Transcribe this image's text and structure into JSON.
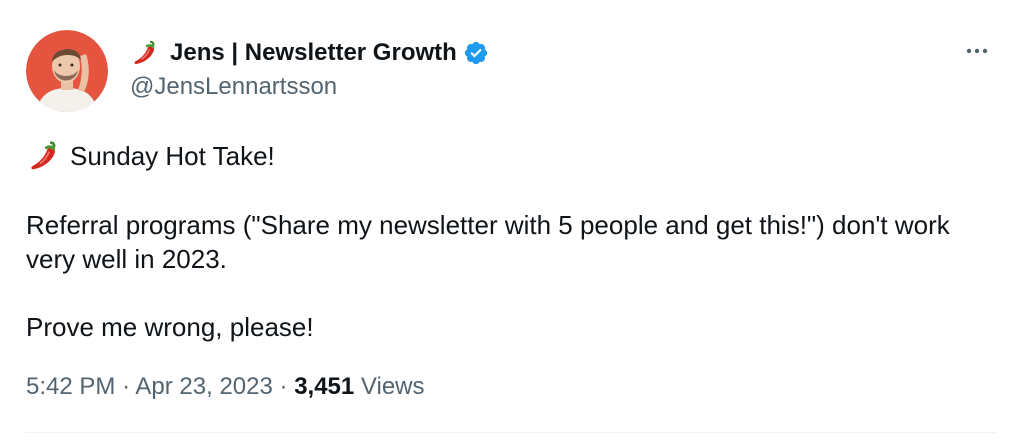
{
  "author": {
    "name": "Jens | Newsletter Growth",
    "handle": "@JensLennartsson",
    "name_emoji_icon": "chili-pepper-icon",
    "verified_icon": "verified-badge-icon",
    "verified_color": "#1d9bf0"
  },
  "tweet": {
    "line1_emoji_icon": "chili-pepper-icon",
    "line1": "Sunday Hot Take!",
    "para2": "Referral programs (\"Share my newsletter with 5 people and get this!\") don't work very well in 2023.",
    "para3": "Prove me wrong, please!"
  },
  "meta": {
    "time": "5:42 PM",
    "separator1": "·",
    "date": "Apr 23, 2023",
    "separator2": "·",
    "views_count": "3,451",
    "views_label": "Views"
  },
  "actions": {
    "more_icon": "more-horizontal-icon"
  },
  "colors": {
    "text_primary": "#0f1419",
    "text_secondary": "#536471",
    "divider": "#eff3f4",
    "avatar_bg": "#e5543f"
  }
}
